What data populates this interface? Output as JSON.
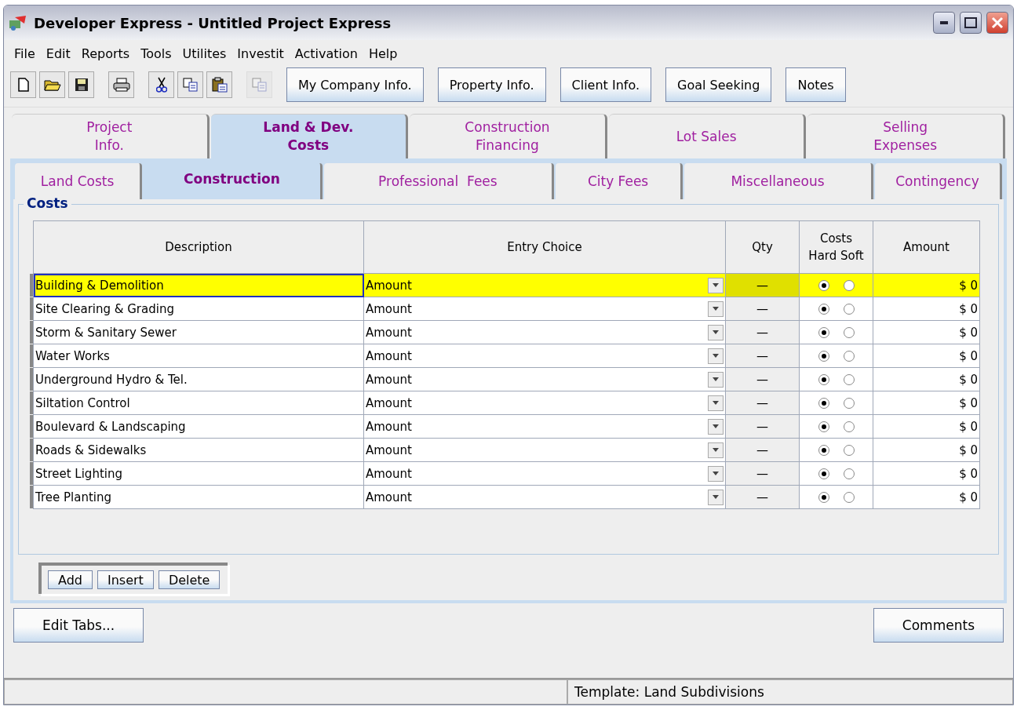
{
  "window": {
    "title": "Developer Express - Untitled Project Express"
  },
  "menu": [
    "File",
    "Edit",
    "Reports",
    "Tools",
    "Utilites",
    "Investit",
    "Activation",
    "Help"
  ],
  "toolbar": {
    "icons": [
      {
        "kind": "new",
        "disabled": false
      },
      {
        "kind": "open",
        "disabled": false
      },
      {
        "kind": "save",
        "disabled": false
      },
      {
        "kind": "print",
        "disabled": false
      },
      {
        "kind": "cut",
        "disabled": false
      },
      {
        "kind": "copy",
        "disabled": false
      },
      {
        "kind": "paste",
        "disabled": false
      },
      {
        "kind": "copy",
        "disabled": true
      }
    ],
    "buttons": [
      "My Company Info.",
      "Property Info.",
      "Client Info.",
      "Goal Seeking",
      "Notes"
    ]
  },
  "tabs": [
    {
      "label": "Project\nInfo.",
      "selected": false
    },
    {
      "label": "Land & Dev.\nCosts",
      "selected": true
    },
    {
      "label": "Construction\nFinancing",
      "selected": false
    },
    {
      "label": "Lot Sales",
      "selected": false
    },
    {
      "label": "Selling\nExpenses",
      "selected": false
    }
  ],
  "subtabs": [
    {
      "label": "Land Costs",
      "selected": false
    },
    {
      "label": "Construction",
      "selected": true
    },
    {
      "label": "Professional  Fees",
      "selected": false
    },
    {
      "label": "City Fees",
      "selected": false
    },
    {
      "label": "Miscellaneous",
      "selected": false
    },
    {
      "label": "Contingency",
      "selected": false
    }
  ],
  "panel": {
    "title": "Costs",
    "table": {
      "columns": [
        "Description",
        "Entry Choice",
        "Qty",
        "Costs\nHard Soft",
        "Amount"
      ],
      "rows": [
        {
          "description": "Building & Demolition",
          "entry_choice": "Amount",
          "qty": "—",
          "hard": true,
          "soft": false,
          "amount": "$ 0",
          "selected": true
        },
        {
          "description": "Site Clearing & Grading",
          "entry_choice": "Amount",
          "qty": "—",
          "hard": true,
          "soft": false,
          "amount": "$ 0",
          "selected": false
        },
        {
          "description": "Storm & Sanitary Sewer",
          "entry_choice": "Amount",
          "qty": "—",
          "hard": true,
          "soft": false,
          "amount": "$ 0",
          "selected": false
        },
        {
          "description": "Water Works",
          "entry_choice": "Amount",
          "qty": "—",
          "hard": true,
          "soft": false,
          "amount": "$ 0",
          "selected": false
        },
        {
          "description": "Underground Hydro & Tel.",
          "entry_choice": "Amount",
          "qty": "—",
          "hard": true,
          "soft": false,
          "amount": "$ 0",
          "selected": false
        },
        {
          "description": "Siltation Control",
          "entry_choice": "Amount",
          "qty": "—",
          "hard": true,
          "soft": false,
          "amount": "$ 0",
          "selected": false
        },
        {
          "description": "Boulevard & Landscaping",
          "entry_choice": "Amount",
          "qty": "—",
          "hard": true,
          "soft": false,
          "amount": "$ 0",
          "selected": false
        },
        {
          "description": "Roads & Sidewalks",
          "entry_choice": "Amount",
          "qty": "—",
          "hard": true,
          "soft": false,
          "amount": "$ 0",
          "selected": false
        },
        {
          "description": "Street Lighting",
          "entry_choice": "Amount",
          "qty": "—",
          "hard": true,
          "soft": false,
          "amount": "$ 0",
          "selected": false
        },
        {
          "description": "Tree Planting",
          "entry_choice": "Amount",
          "qty": "—",
          "hard": true,
          "soft": false,
          "amount": "$ 0",
          "selected": false
        }
      ]
    },
    "row_buttons": [
      "Add",
      "Insert",
      "Delete"
    ]
  },
  "footer_buttons": [
    "Edit Tabs...",
    "Comments"
  ],
  "status_bar": {
    "template": "Template: Land Subdivisions"
  }
}
